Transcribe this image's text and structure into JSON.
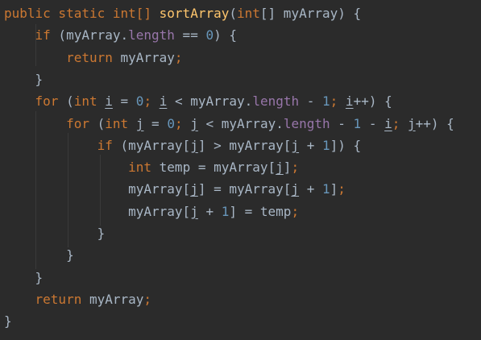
{
  "editor": {
    "language": "java",
    "theme_colors": {
      "background": "#2b2b2b",
      "text": "#a9b7c6",
      "keyword": "#cc7832",
      "method_name": "#ffc66d",
      "number": "#6897bb",
      "field": "#9876aa"
    },
    "lines": [
      {
        "tokens": [
          {
            "t": "public static int[] ",
            "c": "kw"
          },
          {
            "t": "sortArray",
            "c": "fn"
          },
          {
            "t": "(",
            "c": "txt"
          },
          {
            "t": "int",
            "c": "kw"
          },
          {
            "t": "[] myArray) {",
            "c": "txt"
          }
        ]
      },
      {
        "tokens": [
          {
            "t": "    ",
            "c": "txt"
          },
          {
            "t": "if",
            "c": "kw"
          },
          {
            "t": " (myArray.",
            "c": "txt"
          },
          {
            "t": "length",
            "c": "fld"
          },
          {
            "t": " == ",
            "c": "txt"
          },
          {
            "t": "0",
            "c": "num"
          },
          {
            "t": ") {",
            "c": "txt"
          }
        ]
      },
      {
        "tokens": [
          {
            "t": "        ",
            "c": "txt"
          },
          {
            "t": "return",
            "c": "kw"
          },
          {
            "t": " myArray",
            "c": "txt"
          },
          {
            "t": ";",
            "c": "kw"
          }
        ]
      },
      {
        "tokens": [
          {
            "t": "    }",
            "c": "txt"
          }
        ]
      },
      {
        "tokens": [
          {
            "t": "    ",
            "c": "txt"
          },
          {
            "t": "for",
            "c": "kw"
          },
          {
            "t": " (",
            "c": "txt"
          },
          {
            "t": "int",
            "c": "kw"
          },
          {
            "t": " ",
            "c": "txt"
          },
          {
            "t": "i",
            "c": "txt",
            "u": true
          },
          {
            "t": " = ",
            "c": "txt"
          },
          {
            "t": "0",
            "c": "num"
          },
          {
            "t": "; ",
            "c": "kw"
          },
          {
            "t": "i",
            "c": "txt",
            "u": true
          },
          {
            "t": " < myArray.",
            "c": "txt"
          },
          {
            "t": "length",
            "c": "fld"
          },
          {
            "t": " - ",
            "c": "txt"
          },
          {
            "t": "1",
            "c": "num"
          },
          {
            "t": "; ",
            "c": "kw"
          },
          {
            "t": "i",
            "c": "txt",
            "u": true
          },
          {
            "t": "++) {",
            "c": "txt"
          }
        ]
      },
      {
        "tokens": [
          {
            "t": "        ",
            "c": "txt"
          },
          {
            "t": "for",
            "c": "kw"
          },
          {
            "t": " (",
            "c": "txt"
          },
          {
            "t": "int",
            "c": "kw"
          },
          {
            "t": " ",
            "c": "txt"
          },
          {
            "t": "j",
            "c": "txt",
            "u": true
          },
          {
            "t": " = ",
            "c": "txt"
          },
          {
            "t": "0",
            "c": "num"
          },
          {
            "t": "; ",
            "c": "kw"
          },
          {
            "t": "j",
            "c": "txt",
            "u": true
          },
          {
            "t": " < myArray.",
            "c": "txt"
          },
          {
            "t": "length",
            "c": "fld"
          },
          {
            "t": " - ",
            "c": "txt"
          },
          {
            "t": "1",
            "c": "num"
          },
          {
            "t": " - ",
            "c": "txt"
          },
          {
            "t": "i",
            "c": "txt",
            "u": true
          },
          {
            "t": "; ",
            "c": "kw"
          },
          {
            "t": "j",
            "c": "txt",
            "u": true
          },
          {
            "t": "++) {",
            "c": "txt"
          }
        ]
      },
      {
        "tokens": [
          {
            "t": "            ",
            "c": "txt"
          },
          {
            "t": "if",
            "c": "kw"
          },
          {
            "t": " (myArray[",
            "c": "txt"
          },
          {
            "t": "j",
            "c": "txt",
            "u": true
          },
          {
            "t": "] > myArray[",
            "c": "txt"
          },
          {
            "t": "j",
            "c": "txt",
            "u": true
          },
          {
            "t": " + ",
            "c": "txt"
          },
          {
            "t": "1",
            "c": "num"
          },
          {
            "t": "]) {",
            "c": "txt"
          }
        ]
      },
      {
        "tokens": [
          {
            "t": "                ",
            "c": "txt"
          },
          {
            "t": "int",
            "c": "kw"
          },
          {
            "t": " temp = myArray[",
            "c": "txt"
          },
          {
            "t": "j",
            "c": "txt",
            "u": true
          },
          {
            "t": "]",
            "c": "txt"
          },
          {
            "t": ";",
            "c": "kw"
          }
        ]
      },
      {
        "tokens": [
          {
            "t": "                myArray[",
            "c": "txt"
          },
          {
            "t": "j",
            "c": "txt",
            "u": true
          },
          {
            "t": "] = myArray[",
            "c": "txt"
          },
          {
            "t": "j",
            "c": "txt",
            "u": true
          },
          {
            "t": " + ",
            "c": "txt"
          },
          {
            "t": "1",
            "c": "num"
          },
          {
            "t": "]",
            "c": "txt"
          },
          {
            "t": ";",
            "c": "kw"
          }
        ]
      },
      {
        "tokens": [
          {
            "t": "                myArray[",
            "c": "txt"
          },
          {
            "t": "j",
            "c": "txt",
            "u": true
          },
          {
            "t": " + ",
            "c": "txt"
          },
          {
            "t": "1",
            "c": "num"
          },
          {
            "t": "] = temp",
            "c": "txt"
          },
          {
            "t": ";",
            "c": "kw"
          }
        ]
      },
      {
        "tokens": [
          {
            "t": "            }",
            "c": "txt"
          }
        ]
      },
      {
        "tokens": [
          {
            "t": "        }",
            "c": "txt"
          }
        ]
      },
      {
        "tokens": [
          {
            "t": "    }",
            "c": "txt"
          }
        ]
      },
      {
        "tokens": [
          {
            "t": "    ",
            "c": "txt"
          },
          {
            "t": "return",
            "c": "kw"
          },
          {
            "t": " myArray",
            "c": "txt"
          },
          {
            "t": ";",
            "c": "kw"
          }
        ]
      },
      {
        "tokens": [
          {
            "t": "}",
            "c": "txt"
          }
        ]
      }
    ]
  }
}
